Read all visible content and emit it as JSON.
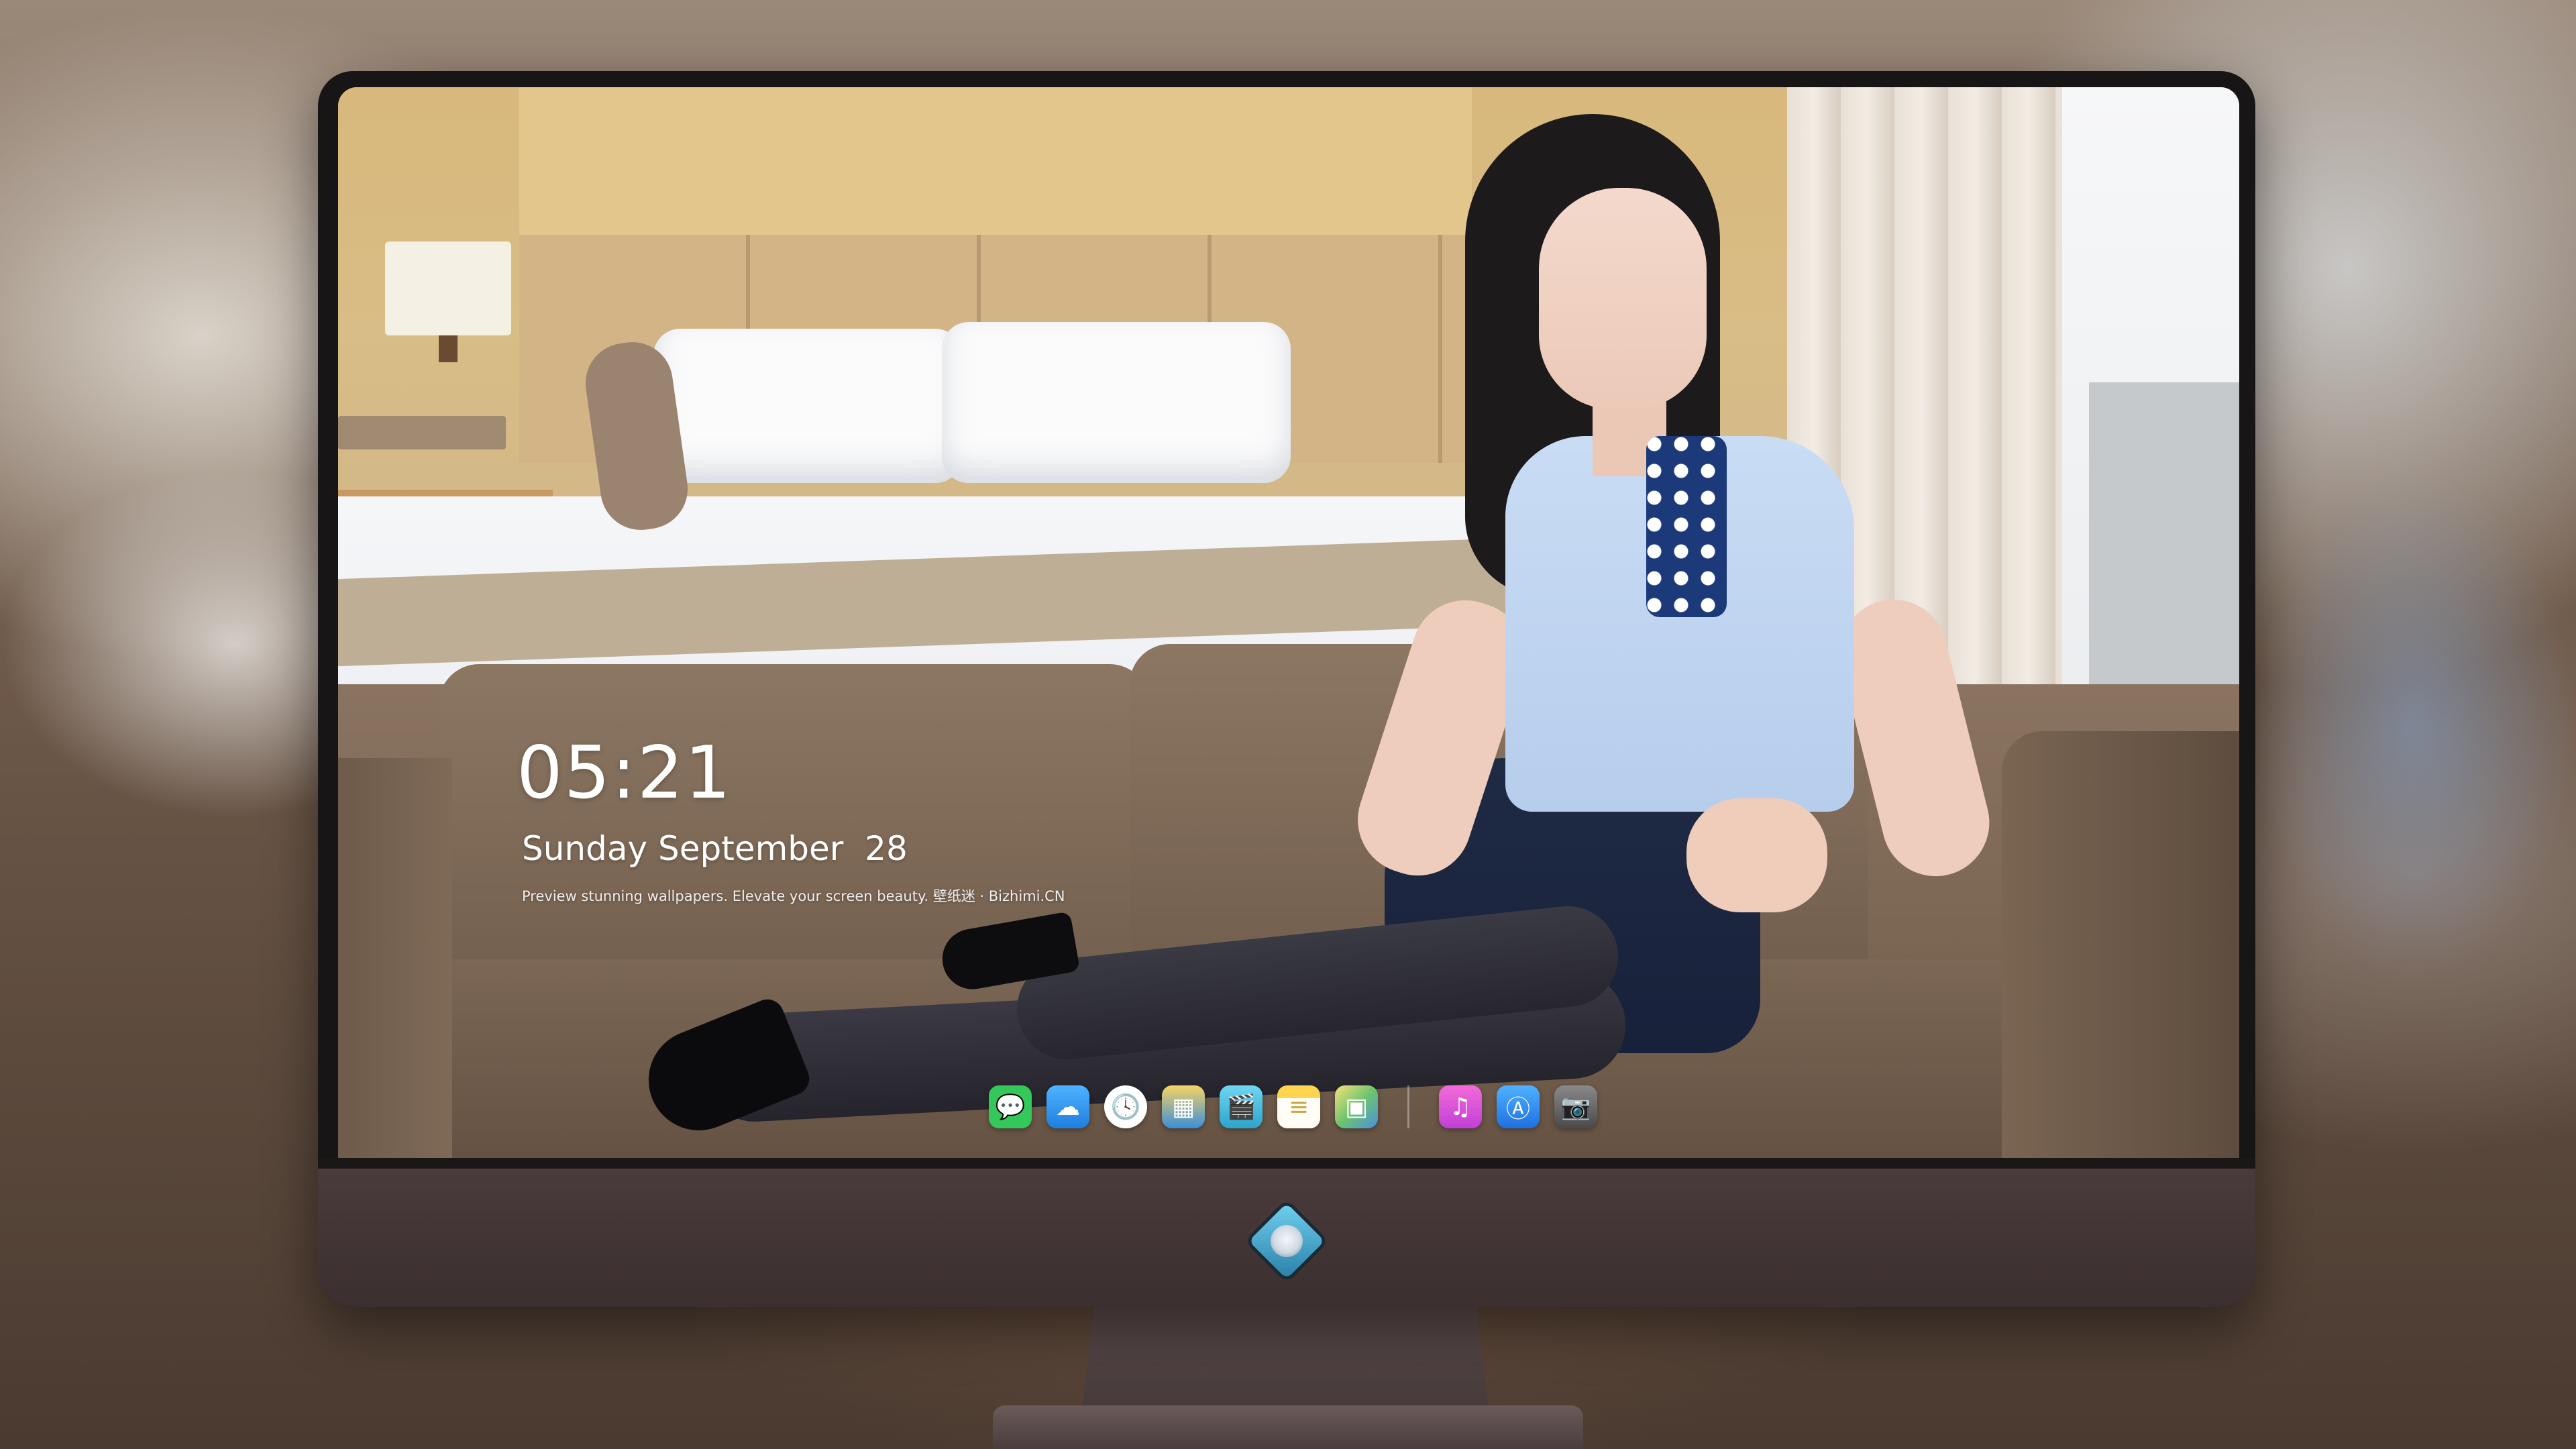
{
  "lockscreen": {
    "time": "05:21",
    "date": "Sunday September  28",
    "tagline": "Preview stunning wallpapers. Elevate your screen beauty. 壁纸迷 · Bizhimi.CN"
  },
  "dock": {
    "apps": [
      {
        "icon": "messages-icon",
        "glyph": "💬",
        "color": "#34c759"
      },
      {
        "icon": "weather-icon",
        "glyph": "☁",
        "color": "#3aa0f0"
      },
      {
        "icon": "clock-icon",
        "glyph": "🕓",
        "color": "#ffffff"
      },
      {
        "icon": "preview-icon",
        "glyph": "▦",
        "color": "#f2c94c"
      },
      {
        "icon": "clips-icon",
        "glyph": "🎬",
        "color": "#5ac8e8"
      },
      {
        "icon": "notes-icon",
        "glyph": "≡",
        "color": "#ffd54f"
      },
      {
        "icon": "photo-booth-icon",
        "glyph": "▣",
        "color": "#f7e27a"
      }
    ],
    "apps_right": [
      {
        "icon": "music-icon",
        "glyph": "♫",
        "color": "#e94fd8"
      },
      {
        "icon": "app-store-icon",
        "glyph": "Ⓐ",
        "color": "#2d8cf0"
      },
      {
        "icon": "camera-icon",
        "glyph": "📷",
        "color": "#5a5a5a"
      }
    ]
  },
  "colors": {
    "bezel": "#171515",
    "chin": "#3b2f30",
    "logo": "#4fb6e0"
  }
}
